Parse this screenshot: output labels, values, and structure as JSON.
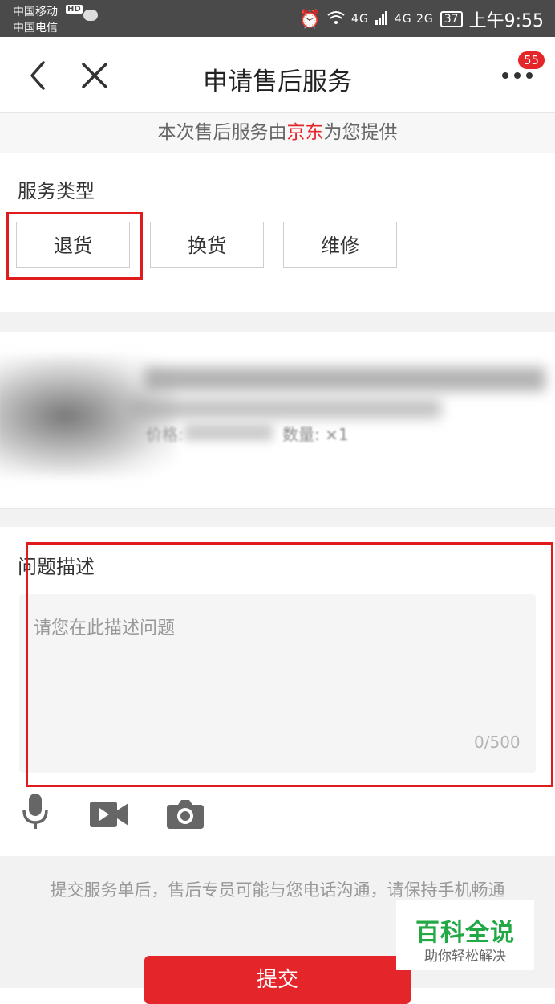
{
  "status_bar": {
    "carrier_1": "中国移动",
    "hd_badge": "HD",
    "carrier_2": "中国电信",
    "network_4g": "4G",
    "network_4g2g": "4G 2G",
    "battery": "37",
    "time": "上午9:55"
  },
  "nav": {
    "title": "申请售后服务",
    "badge_count": "55"
  },
  "banner": {
    "prefix": "本次售后服务由",
    "brand": "京东",
    "suffix": "为您提供"
  },
  "service_type": {
    "label": "服务类型",
    "options": [
      "退货",
      "换货",
      "维修"
    ]
  },
  "product": {
    "price_label": "价格:",
    "quantity": "数量: ×1"
  },
  "description": {
    "label": "问题描述",
    "placeholder": "请您在此描述问题",
    "counter": "0/500"
  },
  "media_icons": [
    "microphone-icon",
    "video-icon",
    "camera-icon"
  ],
  "footer": {
    "notice": "提交服务单后，售后专员可能与您电话沟通，请保持手机畅通",
    "submit_label": "提交"
  },
  "watermark": {
    "title": "百科全说",
    "subtitle": "助你轻松解决"
  },
  "colors": {
    "accent": "#e4262b",
    "highlight": "#e01b1b",
    "watermark_green": "#22a845"
  }
}
